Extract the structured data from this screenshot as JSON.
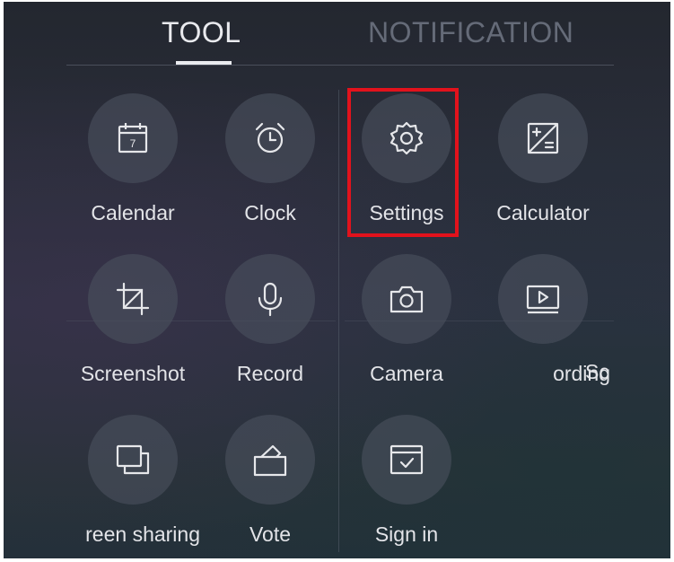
{
  "tabs": {
    "tool": "TOOL",
    "notification": "NOTIFICATION"
  },
  "tools": [
    {
      "label": "Calendar",
      "icon": "calendar-icon",
      "calendar_day": "7"
    },
    {
      "label": "Clock",
      "icon": "alarm-clock-icon"
    },
    {
      "label": "Settings",
      "icon": "gear-icon"
    },
    {
      "label": "Calculator",
      "icon": "calculator-icon"
    },
    {
      "label": "Screenshot",
      "icon": "crop-icon"
    },
    {
      "label": "Record",
      "icon": "microphone-icon"
    },
    {
      "label": "Camera",
      "icon": "camera-icon"
    },
    {
      "label": "ording",
      "icon": "screen-recording-icon"
    },
    {
      "label": "reen sharing",
      "icon": "screen-sharing-icon"
    },
    {
      "label": "Vote",
      "icon": "vote-icon"
    },
    {
      "label": "Sign in",
      "icon": "sign-in-icon"
    }
  ],
  "partial_label": "Sc",
  "highlight": {
    "target": "Settings",
    "color": "#e2121c"
  }
}
